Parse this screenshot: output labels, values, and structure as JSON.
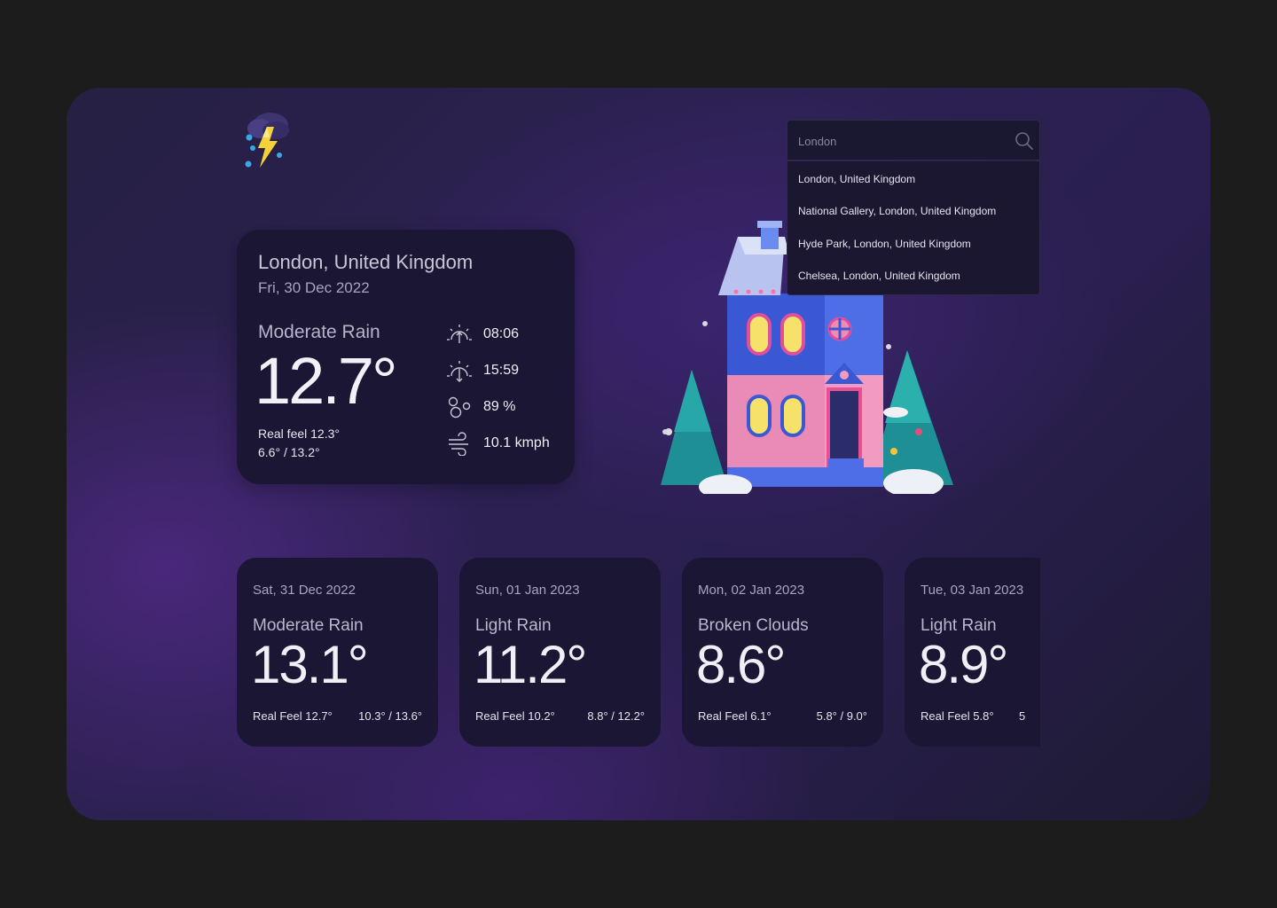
{
  "search": {
    "value": "London",
    "suggestions": [
      "London, United Kingdom",
      "National Gallery, London, United Kingdom",
      "Hyde Park, London, United Kingdom",
      "Chelsea, London, United Kingdom"
    ]
  },
  "current": {
    "location": "London, United Kingdom",
    "date": "Fri, 30 Dec 2022",
    "condition": "Moderate Rain",
    "temperature": "12.7°",
    "real_feel": "Real feel 12.3°",
    "range": "6.6° / 13.2°",
    "sunrise": "08:06",
    "sunset": "15:59",
    "humidity": "89 %",
    "wind": "10.1 kmph"
  },
  "forecast": [
    {
      "date": "Sat, 31 Dec 2022",
      "condition": "Moderate Rain",
      "temperature": "13.1°",
      "real_feel": "Real Feel 12.7°",
      "range": "10.3° / 13.6°"
    },
    {
      "date": "Sun, 01 Jan 2023",
      "condition": "Light Rain",
      "temperature": "11.2°",
      "real_feel": "Real Feel 10.2°",
      "range": "8.8° / 12.2°"
    },
    {
      "date": "Mon, 02 Jan 2023",
      "condition": "Broken Clouds",
      "temperature": "8.6°",
      "real_feel": "Real Feel 6.1°",
      "range": "5.8° / 9.0°"
    },
    {
      "date": "Tue, 03 Jan 2023",
      "condition": "Light Rain",
      "temperature": "8.9°",
      "real_feel": "Real Feel 5.8°",
      "range": "5"
    }
  ],
  "icons": {
    "logo": "storm-cloud-icon",
    "search": "search-icon",
    "sunrise": "sunrise-icon",
    "sunset": "sunset-icon",
    "humidity": "humidity-icon",
    "wind": "wind-icon"
  }
}
